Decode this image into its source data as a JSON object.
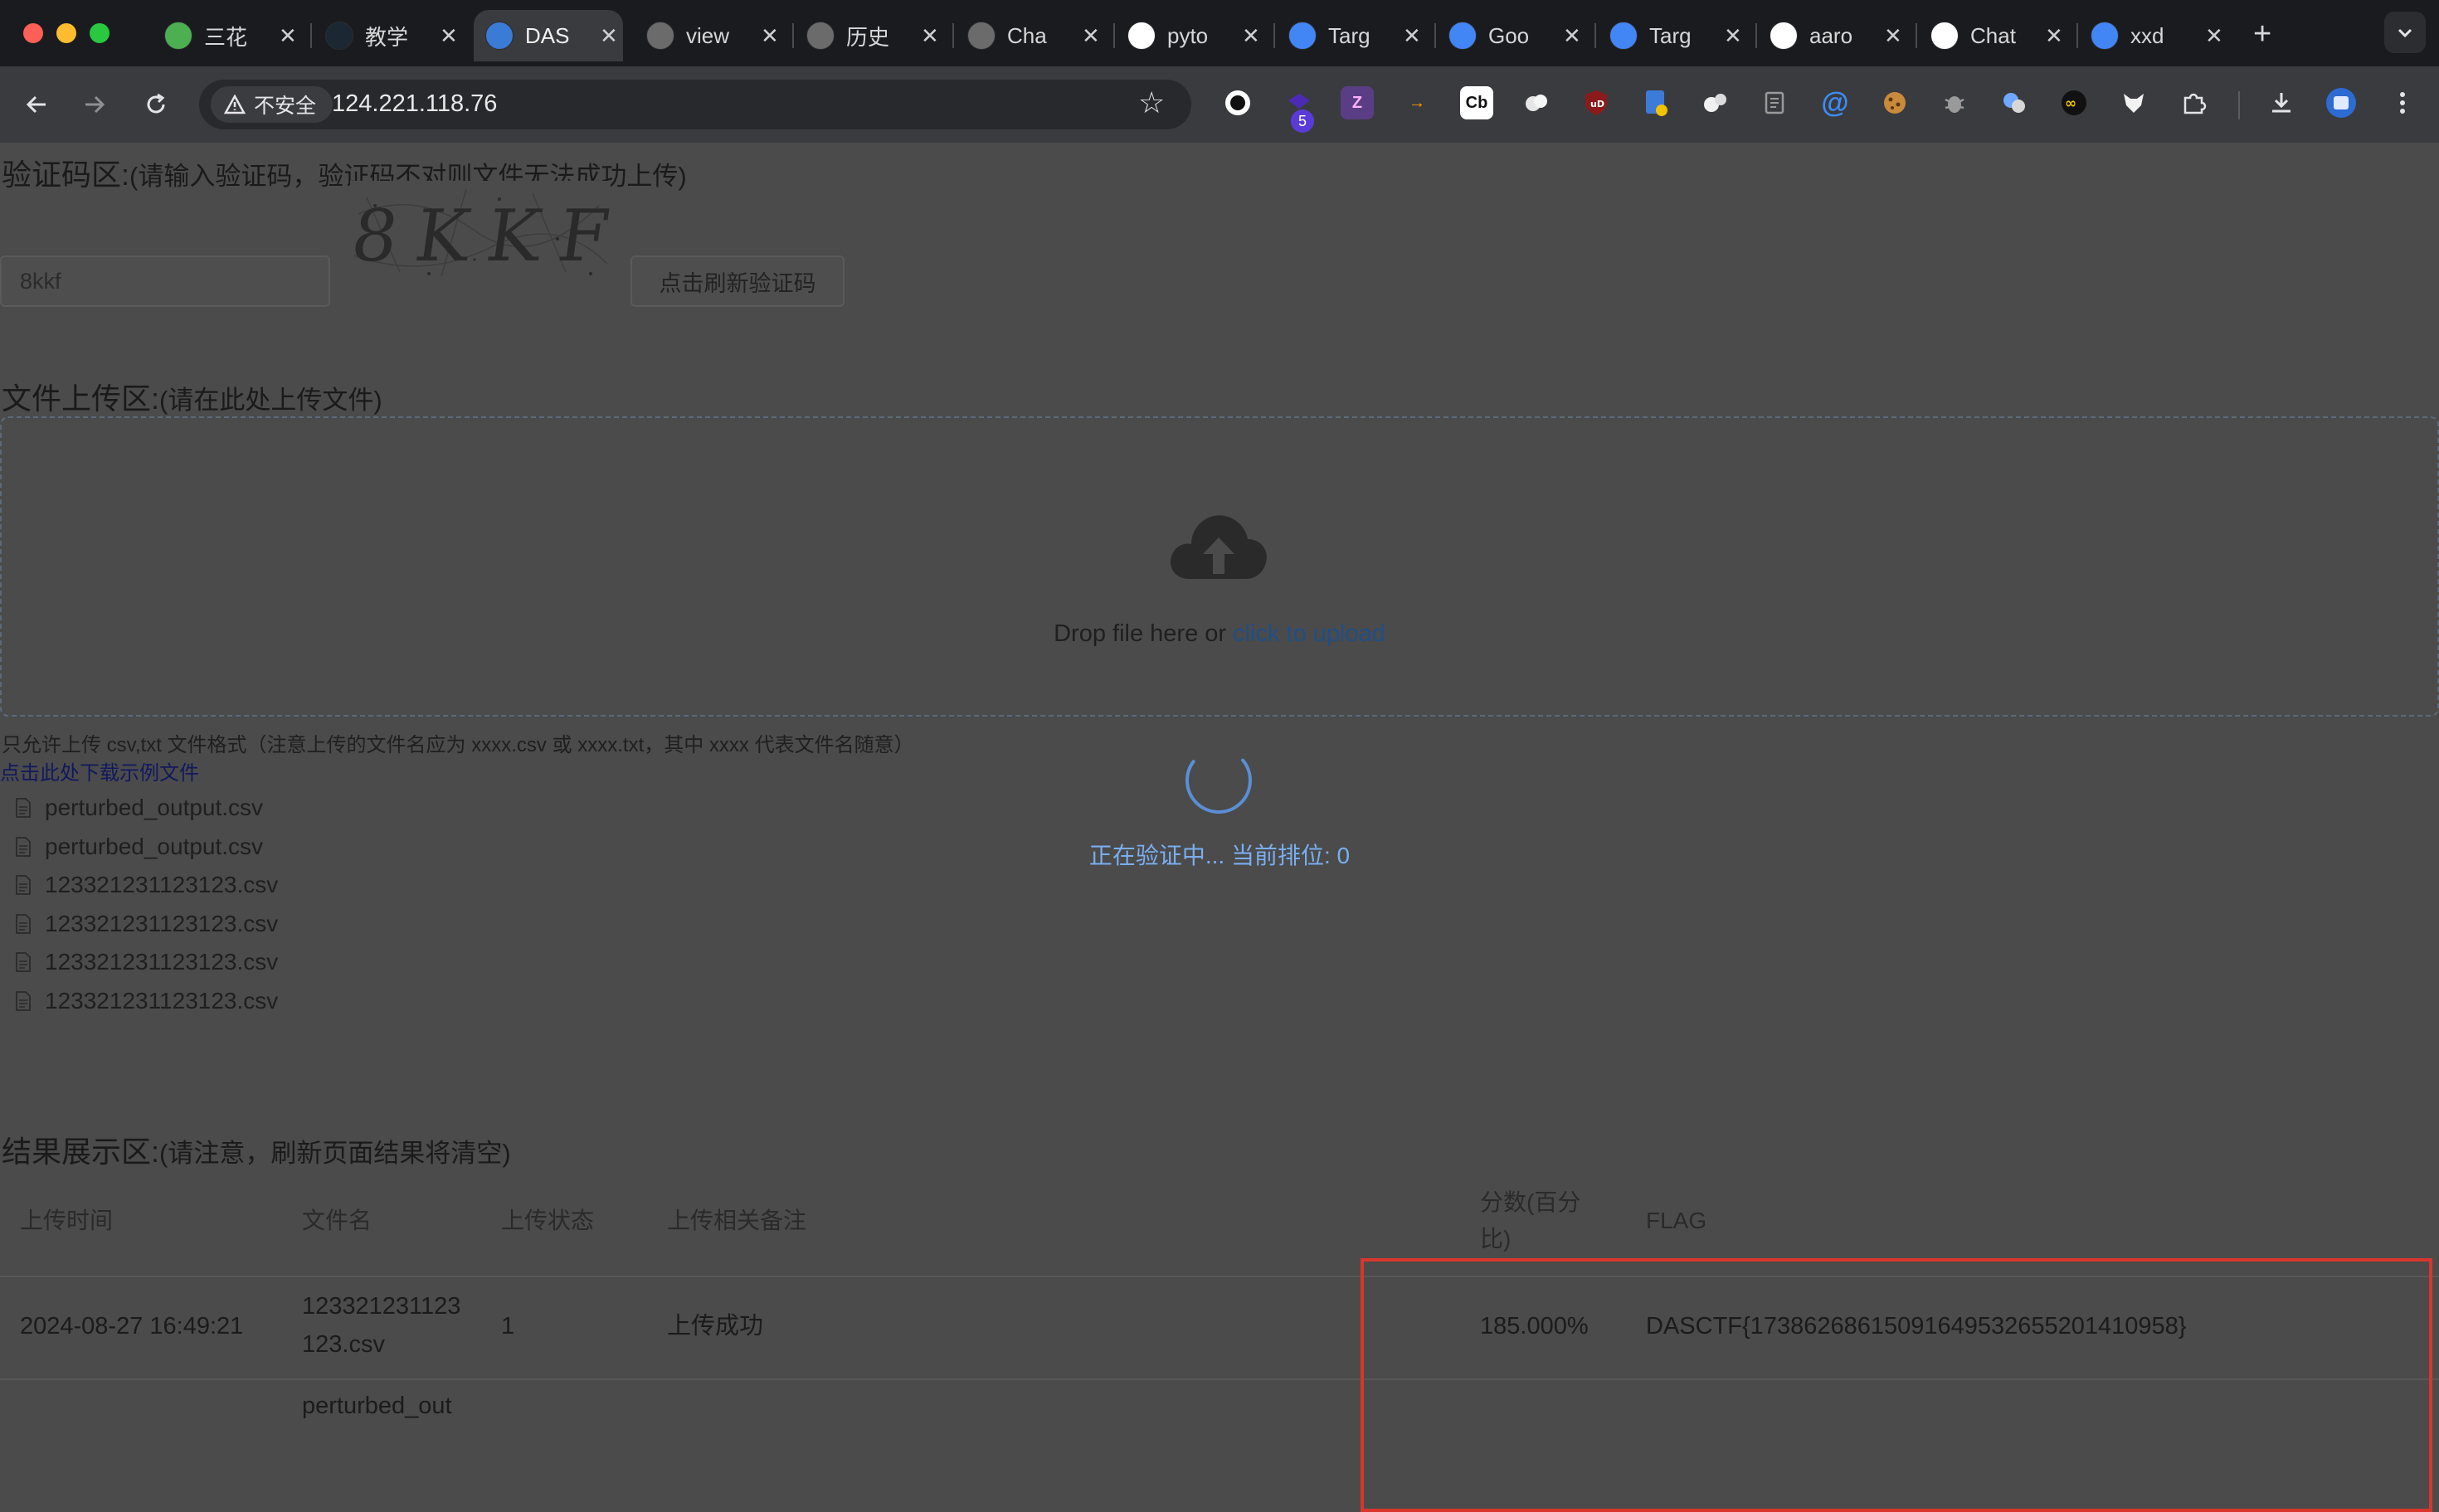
{
  "browser": {
    "tabs": [
      {
        "label": "三花",
        "favicon": "leaf-icon",
        "color": "#4caf50"
      },
      {
        "label": "教学",
        "favicon": "dark-app-icon",
        "color": "#1b2733"
      },
      {
        "label": "DAS",
        "favicon": "hexagon-icon",
        "color": "#3a7bd5"
      },
      {
        "label": "view",
        "favicon": "globe-icon",
        "color": "#6b6b6b"
      },
      {
        "label": "历史",
        "favicon": "history-icon",
        "color": "#6b6b6b"
      },
      {
        "label": "Cha",
        "favicon": "globe-icon",
        "color": "#6b6b6b"
      },
      {
        "label": "pyto",
        "favicon": "github-icon",
        "color": "#ffffff"
      },
      {
        "label": "Targ",
        "favicon": "google-icon",
        "color": "#4285f4"
      },
      {
        "label": "Goo",
        "favicon": "translate-icon",
        "color": "#4285f4"
      },
      {
        "label": "Targ",
        "favicon": "google-icon",
        "color": "#4285f4"
      },
      {
        "label": "aaro",
        "favicon": "github-icon",
        "color": "#ffffff"
      },
      {
        "label": "Chat",
        "favicon": "openai-icon",
        "color": "#ffffff"
      },
      {
        "label": "xxd",
        "favicon": "google-icon",
        "color": "#4285f4"
      }
    ],
    "security_label": "不安全",
    "url": "124.221.118.76",
    "extension_badge": "5"
  },
  "captcha": {
    "title": "验证码区:",
    "note": "(请输入验证码，验证码不对则文件无法成功上传)",
    "input_value": "8kkf",
    "image_text": "8KKF",
    "refresh_label": "点击刷新验证码"
  },
  "upload": {
    "title": "文件上传区:",
    "note": "(请在此处上传文件)",
    "drop_text": "Drop file here or ",
    "drop_link": "click to upload",
    "hint": "只允许上传 csv,txt 文件格式（注意上传的文件名应为 xxxx.csv 或 xxxx.txt，其中 xxxx 代表文件名随意）",
    "download_link": "点击此处下载示例文件",
    "files": [
      "perturbed_output.csv",
      "perturbed_output.csv",
      "123321231123123.csv",
      "123321231123123.csv",
      "123321231123123.csv",
      "123321231123123.csv"
    ],
    "verifying_text": "正在验证中... 当前排位: 0"
  },
  "results": {
    "title": "结果展示区:",
    "note": "(请注意，刷新页面结果将清空)",
    "columns": {
      "time": "上传时间",
      "filename": "文件名",
      "status": "上传状态",
      "remark": "上传相关备注",
      "score_line1": "分数(百分",
      "score_line2": "比)",
      "flag": "FLAG"
    },
    "rows": [
      {
        "time": "2024-08-27 16:49:21",
        "filename_line1": "123321231123",
        "filename_line2": "123.csv",
        "status": "1",
        "remark": "上传成功",
        "score": "185.000%",
        "flag": "DASCTF{17386268615091649532655201410958}"
      },
      {
        "filename_line1": "perturbed_out"
      }
    ]
  },
  "colors": {
    "accent": "#4a90e2",
    "highlight": "#d8362c"
  }
}
